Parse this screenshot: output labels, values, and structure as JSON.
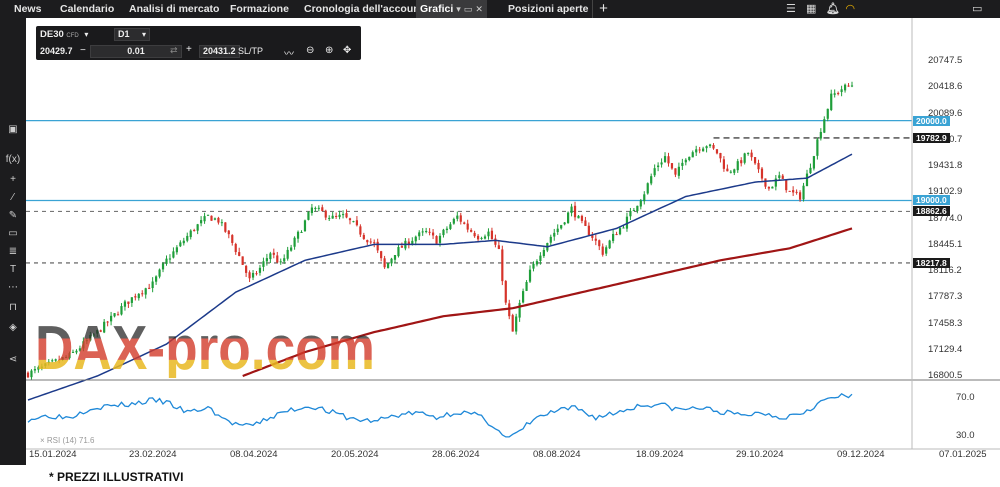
{
  "topbar": {
    "tabs": [
      {
        "label": "News",
        "active": false
      },
      {
        "label": "Calendario",
        "active": false
      },
      {
        "label": "Analisi di mercato",
        "active": false
      },
      {
        "label": "Formazione",
        "active": false
      },
      {
        "label": "Cronologia dell'account",
        "active": false
      },
      {
        "label": "Grafici",
        "active": true
      },
      {
        "label": "Posizioni aperte",
        "active": false
      }
    ],
    "add_tab": "+",
    "icons": [
      "menu-icon",
      "bell-icon",
      "wifi-icon",
      "window-icon"
    ]
  },
  "left_toolbar": {
    "icons": [
      "panel-icon",
      "function-icon",
      "crosshair-icon",
      "line-tool-icon",
      "brush-icon",
      "rectangle-icon",
      "fibonacci-icon",
      "text-icon",
      "more-icon",
      "magnet-icon",
      "layers-icon",
      "share-icon"
    ]
  },
  "trade_box": {
    "symbol": "DE30",
    "symbol_type": "CFD",
    "timeframe": "D1",
    "bid": "20429.7",
    "minus": "−",
    "volume": "0.01",
    "plus": "+",
    "ask": "20431.2",
    "sltp": "SL/TP",
    "tool_icons": [
      "line-chart-icon",
      "zoom-out-icon",
      "zoom-in-icon",
      "move-icon"
    ]
  },
  "price_tags": [
    {
      "label": "20000.0",
      "value": 20000.0,
      "color": "#3aa3d4"
    },
    {
      "label": "19782.9",
      "value": 19782.9,
      "color": "#1a1a1a"
    },
    {
      "label": "19000.0",
      "value": 19000.0,
      "color": "#3aa3d4"
    },
    {
      "label": "18862.6",
      "value": 18862.6,
      "color": "#1a1a1a"
    },
    {
      "label": "18217.8",
      "value": 18217.8,
      "color": "#1a1a1a"
    }
  ],
  "watermark": "DAX-pro.com",
  "rsi_label": "× RSI (14) 71.6",
  "footer_note": "* PREZZI ILLUSTRATIVI",
  "chart_data": {
    "type": "candlestick",
    "symbol": "DE30",
    "timeframe": "D1",
    "y_ticks": [
      "20747.5",
      "20418.6",
      "20089.6",
      "19760.7",
      "19431.8",
      "19102.9",
      "18774.0",
      "18445.1",
      "18116.2",
      "17787.3",
      "17458.3",
      "17129.4",
      "16800.5"
    ],
    "ylim": [
      16800.5,
      20747.5
    ],
    "x_ticks": [
      "15.01.2024",
      "23.02.2024",
      "08.04.2024",
      "20.05.2024",
      "28.06.2024",
      "08.08.2024",
      "18.09.2024",
      "29.10.2024",
      "09.12.2024",
      "07.01.2025"
    ],
    "horizontal_lines": [
      {
        "value": 20000.0,
        "style": "solid",
        "color": "#3aa3d4"
      },
      {
        "value": 19782.9,
        "style": "dashed",
        "color": "#1a1a1a"
      },
      {
        "value": 19000.0,
        "style": "solid",
        "color": "#3aa3d4"
      },
      {
        "value": 18862.6,
        "style": "dashed",
        "color": "#777777"
      },
      {
        "value": 18217.8,
        "style": "dashed",
        "color": "#555555"
      }
    ],
    "price_path": [
      [
        0,
        16830
      ],
      [
        4,
        16900
      ],
      [
        8,
        16980
      ],
      [
        12,
        17050
      ],
      [
        16,
        17200
      ],
      [
        20,
        17350
      ],
      [
        24,
        17520
      ],
      [
        28,
        17700
      ],
      [
        32,
        17850
      ],
      [
        36,
        17950
      ],
      [
        40,
        18250
      ],
      [
        44,
        18450
      ],
      [
        48,
        18650
      ],
      [
        52,
        18800
      ],
      [
        55,
        18750
      ],
      [
        58,
        18550
      ],
      [
        61,
        18300
      ],
      [
        64,
        18000
      ],
      [
        67,
        18150
      ],
      [
        70,
        18350
      ],
      [
        73,
        18200
      ],
      [
        76,
        18420
      ],
      [
        79,
        18650
      ],
      [
        82,
        18900
      ],
      [
        85,
        18850
      ],
      [
        88,
        18780
      ],
      [
        91,
        18800
      ],
      [
        94,
        18700
      ],
      [
        97,
        18550
      ],
      [
        100,
        18450
      ],
      [
        103,
        18150
      ],
      [
        106,
        18350
      ],
      [
        109,
        18450
      ],
      [
        112,
        18550
      ],
      [
        115,
        18600
      ],
      [
        118,
        18500
      ],
      [
        121,
        18650
      ],
      [
        124,
        18800
      ],
      [
        127,
        18650
      ],
      [
        130,
        18550
      ],
      [
        133,
        18600
      ],
      [
        136,
        18350
      ],
      [
        138,
        17700
      ],
      [
        140,
        17350
      ],
      [
        142,
        17700
      ],
      [
        145,
        18100
      ],
      [
        148,
        18350
      ],
      [
        151,
        18550
      ],
      [
        154,
        18700
      ],
      [
        157,
        18900
      ],
      [
        160,
        18700
      ],
      [
        163,
        18550
      ],
      [
        166,
        18350
      ],
      [
        169,
        18550
      ],
      [
        172,
        18700
      ],
      [
        175,
        18900
      ],
      [
        178,
        19100
      ],
      [
        181,
        19400
      ],
      [
        184,
        19550
      ],
      [
        187,
        19300
      ],
      [
        190,
        19550
      ],
      [
        193,
        19650
      ],
      [
        196,
        19700
      ],
      [
        199,
        19600
      ],
      [
        202,
        19350
      ],
      [
        205,
        19450
      ],
      [
        208,
        19600
      ],
      [
        211,
        19350
      ],
      [
        214,
        19150
      ],
      [
        217,
        19300
      ],
      [
        220,
        19100
      ],
      [
        223,
        19050
      ],
      [
        226,
        19450
      ],
      [
        229,
        19900
      ],
      [
        232,
        20300
      ],
      [
        235,
        20400
      ],
      [
        238,
        20450
      ]
    ],
    "sma_blue": [
      [
        0,
        16500
      ],
      [
        20,
        16800
      ],
      [
        40,
        17200
      ],
      [
        60,
        17850
      ],
      [
        80,
        18250
      ],
      [
        100,
        18450
      ],
      [
        120,
        18450
      ],
      [
        135,
        18500
      ],
      [
        150,
        18420
      ],
      [
        170,
        18650
      ],
      [
        190,
        19050
      ],
      [
        210,
        19230
      ],
      [
        225,
        19280
      ],
      [
        238,
        19580
      ]
    ],
    "sma_red": [
      [
        62,
        16800
      ],
      [
        80,
        17100
      ],
      [
        100,
        17350
      ],
      [
        120,
        17550
      ],
      [
        140,
        17650
      ],
      [
        160,
        17850
      ],
      [
        180,
        18050
      ],
      [
        200,
        18250
      ],
      [
        220,
        18400
      ],
      [
        238,
        18650
      ]
    ],
    "rsi": {
      "ticks": [
        "70.0",
        "30.0"
      ],
      "ylim": [
        20,
        85
      ],
      "values": [
        [
          0,
          48
        ],
        [
          6,
          52
        ],
        [
          12,
          50
        ],
        [
          18,
          60
        ],
        [
          24,
          62
        ],
        [
          30,
          64
        ],
        [
          36,
          68
        ],
        [
          40,
          66
        ],
        [
          46,
          55
        ],
        [
          52,
          60
        ],
        [
          58,
          45
        ],
        [
          64,
          40
        ],
        [
          70,
          50
        ],
        [
          76,
          58
        ],
        [
          82,
          62
        ],
        [
          88,
          55
        ],
        [
          94,
          48
        ],
        [
          100,
          46
        ],
        [
          106,
          52
        ],
        [
          112,
          55
        ],
        [
          118,
          50
        ],
        [
          124,
          56
        ],
        [
          130,
          52
        ],
        [
          135,
          40
        ],
        [
          138,
          28
        ],
        [
          141,
          32
        ],
        [
          146,
          48
        ],
        [
          152,
          56
        ],
        [
          158,
          60
        ],
        [
          164,
          50
        ],
        [
          170,
          55
        ],
        [
          176,
          62
        ],
        [
          182,
          64
        ],
        [
          188,
          58
        ],
        [
          194,
          60
        ],
        [
          200,
          56
        ],
        [
          206,
          52
        ],
        [
          212,
          55
        ],
        [
          218,
          50
        ],
        [
          224,
          56
        ],
        [
          230,
          68
        ],
        [
          234,
          72
        ],
        [
          238,
          71.6
        ]
      ]
    }
  }
}
